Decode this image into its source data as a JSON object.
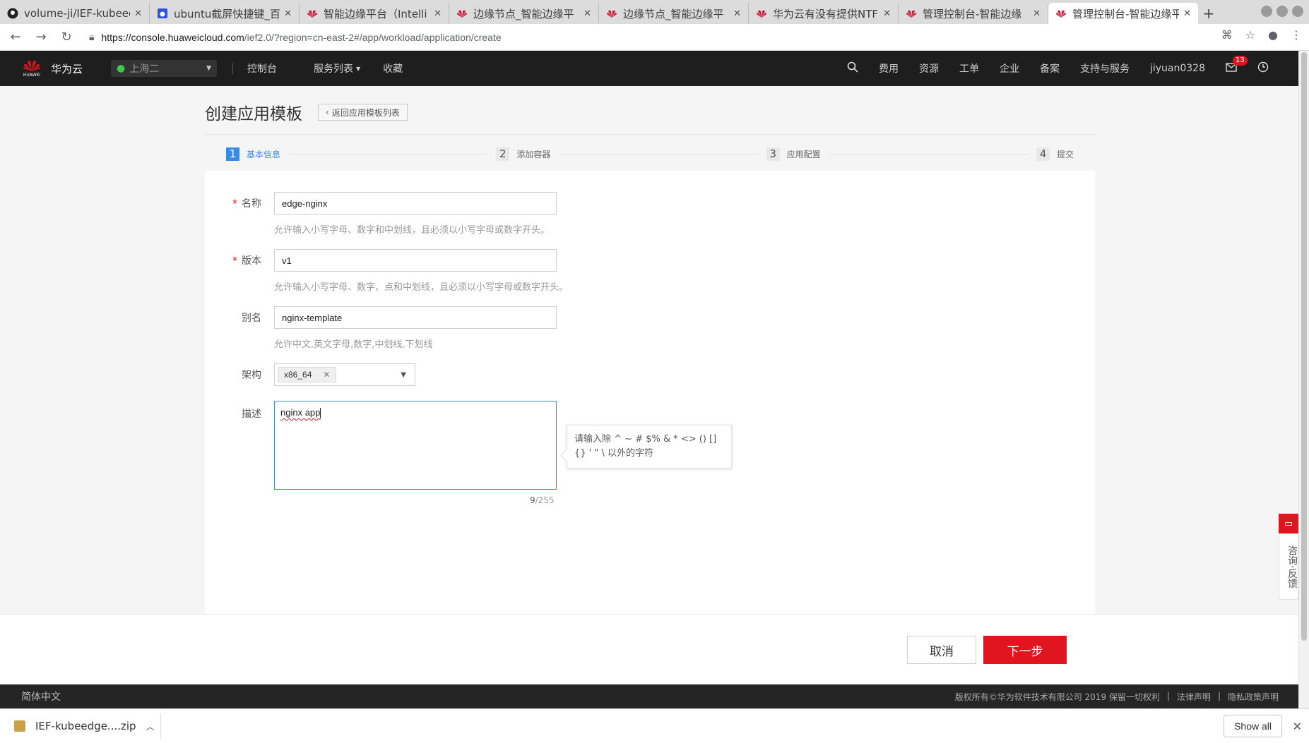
{
  "browser": {
    "tabs": [
      {
        "title": "volume-ji/IEF-kubeed",
        "icon": "github-icon"
      },
      {
        "title": "ubuntu截屏快捷键_百",
        "icon": "baidu-icon"
      },
      {
        "title": "智能边缘平台（Intelli",
        "icon": "huawei-icon"
      },
      {
        "title": "边缘节点_智能边缘平",
        "icon": "huawei-icon"
      },
      {
        "title": "边缘节点_智能边缘平",
        "icon": "huawei-icon"
      },
      {
        "title": "华为云有没有提供NTF",
        "icon": "huawei-icon"
      },
      {
        "title": "管理控制台-智能边缘",
        "icon": "huawei-icon"
      },
      {
        "title": "管理控制台-智能边缘平",
        "icon": "huawei-icon",
        "active": true
      }
    ],
    "url_host": "https://console.huaweicloud.com",
    "url_path": "/ief2.0/?region=cn-east-2#/app/workload/application/create"
  },
  "topnav": {
    "logo_text": "HUAWEI",
    "brand": "华为云",
    "region": "上海二",
    "links": [
      "控制台",
      "服务列表",
      "收藏"
    ],
    "right_links": [
      "费用",
      "资源",
      "工单",
      "企业",
      "备案",
      "支持与服务"
    ],
    "username": "jiyuan0328",
    "message_count": "13",
    "brand_color": "#e0151f"
  },
  "page": {
    "title": "创建应用模板",
    "back_button": "返回应用模板列表",
    "steps": [
      {
        "num": "1",
        "label": "基本信息",
        "active": true
      },
      {
        "num": "2",
        "label": "添加容器"
      },
      {
        "num": "3",
        "label": "应用配置"
      },
      {
        "num": "4",
        "label": "提交"
      }
    ]
  },
  "form": {
    "name": {
      "label": "名称",
      "value": "edge-nginx",
      "hint": "允许输入小写字母、数字和中划线，且必须以小写字母或数字开头。"
    },
    "version": {
      "label": "版本",
      "value": "v1",
      "hint": "允许输入小写字母、数字、点和中划线，且必须以小写字母或数字开头。"
    },
    "alias": {
      "label": "别名",
      "value": "nginx-template",
      "hint": "允许中文,英文字母,数字,中划线,下划线"
    },
    "arch": {
      "label": "架构",
      "value": "x86_64"
    },
    "description": {
      "label": "描述",
      "value": "nginx app",
      "count": "9",
      "max": "/255",
      "tooltip": "请输入除 ^ ~ # $% & * <> () [] {} ' \" \\ 以外的字符"
    }
  },
  "actions": {
    "cancel": "取消",
    "next": "下一步"
  },
  "footer": {
    "language": "简体中文",
    "copyright": "版权所有©华为软件技术有限公司 2019 保留一切权利",
    "legal": "法律声明",
    "privacy": "隐私政策声明"
  },
  "feedback": {
    "label": "咨询·反馈"
  },
  "downloads": {
    "file": "IEF-kubeedge....zip",
    "show_all": "Show all"
  }
}
